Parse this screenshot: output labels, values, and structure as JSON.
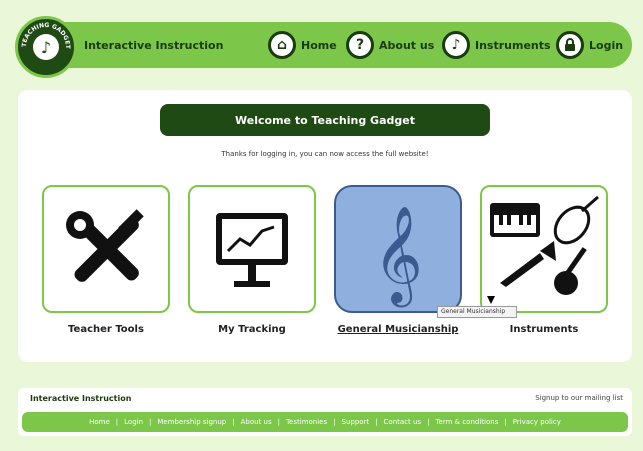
{
  "header": {
    "brand": "Interactive Instruction",
    "logo_ring_text": "TEACHING GADGET",
    "nav": [
      {
        "label": "Home",
        "icon": "home-icon"
      },
      {
        "label": "About us",
        "icon": "question-icon"
      },
      {
        "label": "Instruments",
        "icon": "music-note-icon"
      },
      {
        "label": "Login",
        "icon": "lock-icon"
      }
    ]
  },
  "main": {
    "welcome": "Welcome to Teaching Gadget",
    "message": "Thanks for logging in, you can now access the full website!",
    "tiles": [
      {
        "label": "Teacher Tools",
        "icon": "tools-icon"
      },
      {
        "label": "My Tracking",
        "icon": "chart-monitor-icon"
      },
      {
        "label": "General Musicianship",
        "icon": "treble-clef-icon"
      },
      {
        "label": "Instruments",
        "icon": "instruments-icon"
      }
    ],
    "tooltip": "General Musicianship"
  },
  "footer": {
    "brand": "Interactive Instruction",
    "mailing": "Signup to our mailing list",
    "links": [
      "Home",
      "Login",
      "Membership signup",
      "About us",
      "Testimonies",
      "Support",
      "Contact us",
      "Term & conditions",
      "Privacy policy"
    ]
  },
  "colors": {
    "background": "#eaf7d8",
    "accent_green": "#7cc64a",
    "dark_green": "#1f4a14",
    "active_tile": "#8fb0de"
  }
}
